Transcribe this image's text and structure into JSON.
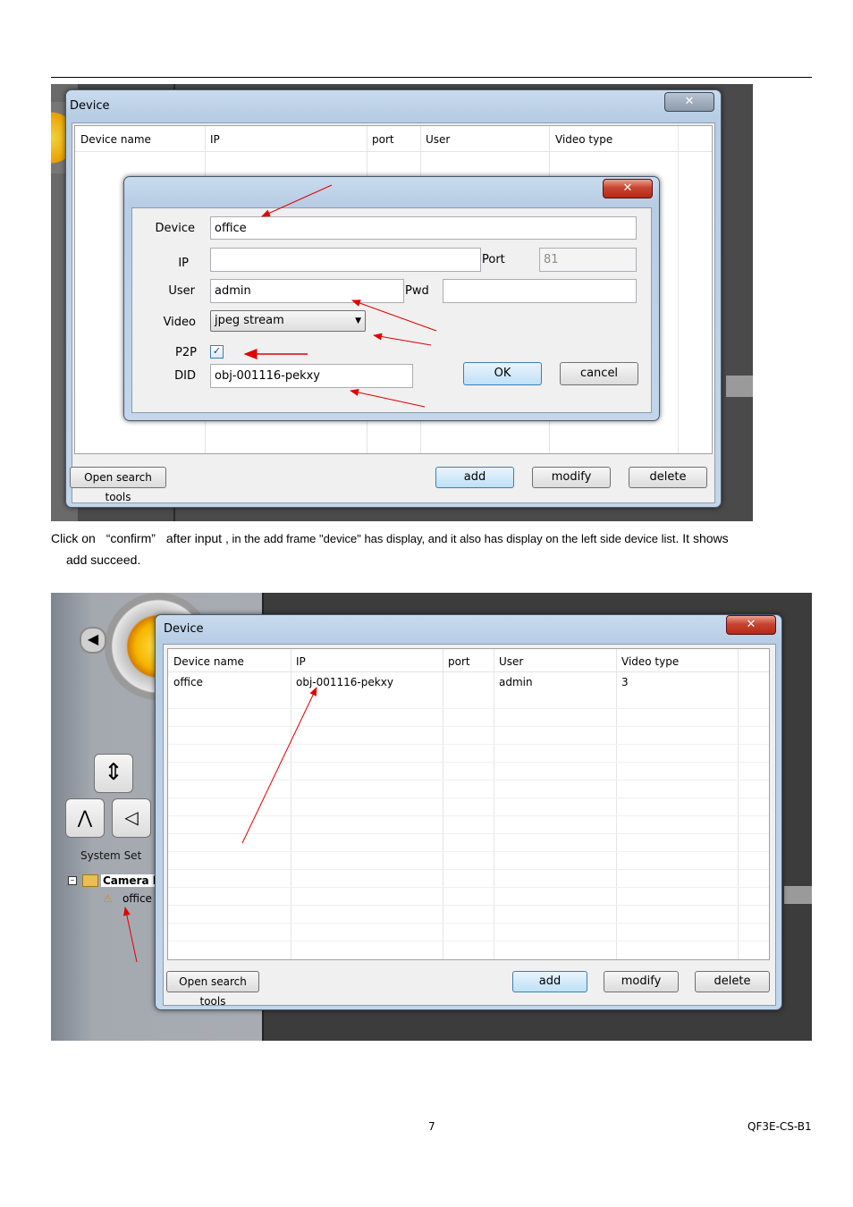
{
  "shot1": {
    "window_title": "Device",
    "close_glyph": "✕",
    "columns": [
      "Device name",
      "IP",
      "port",
      "User",
      "Video type"
    ],
    "dialog": {
      "close_glyph": "✕",
      "device_label": "Device",
      "device_value": "office",
      "ip_label": "IP",
      "ip_value": "",
      "port_label": "Port",
      "port_value": "81",
      "user_label": "User",
      "user_value": "admin",
      "pwd_label": "Pwd",
      "pwd_value": "",
      "video_label": "Video",
      "video_value": "jpeg stream",
      "p2p_label": "P2P",
      "p2p_checked": true,
      "did_label": "DID",
      "did_value": "obj-001116-pekxy",
      "ok_label": "OK",
      "cancel_label": "cancel"
    },
    "buttons": {
      "open_search": "Open search tools",
      "add": "add",
      "modify": "modify",
      "delete": "delete"
    },
    "arrow_color": "#e00000"
  },
  "caption": {
    "part1": "Click on",
    "part2": "“confirm”",
    "part3": "after input ,",
    "part4": " in the add frame \"device\" has display, and it also has display on the left side device list",
    "part5": ". It shows",
    "line2": "add succeed."
  },
  "shot2": {
    "window_title": "Device",
    "close_glyph": "✕",
    "columns": [
      "Device name",
      "IP",
      "port",
      "User",
      "Video type"
    ],
    "rows": [
      {
        "name": "office",
        "ip": "obj-001116-pekxy",
        "port": "",
        "user": "admin",
        "video_type": "3"
      }
    ],
    "buttons": {
      "open_search": "Open search tools",
      "add": "add",
      "modify": "modify",
      "delete": "delete"
    },
    "left_panel": {
      "system_set": "System Set",
      "tree_root": "Camera l",
      "tree_child": "office"
    }
  },
  "footer": {
    "page_number": "7",
    "doc_code": "QF3E-CS-B1"
  }
}
